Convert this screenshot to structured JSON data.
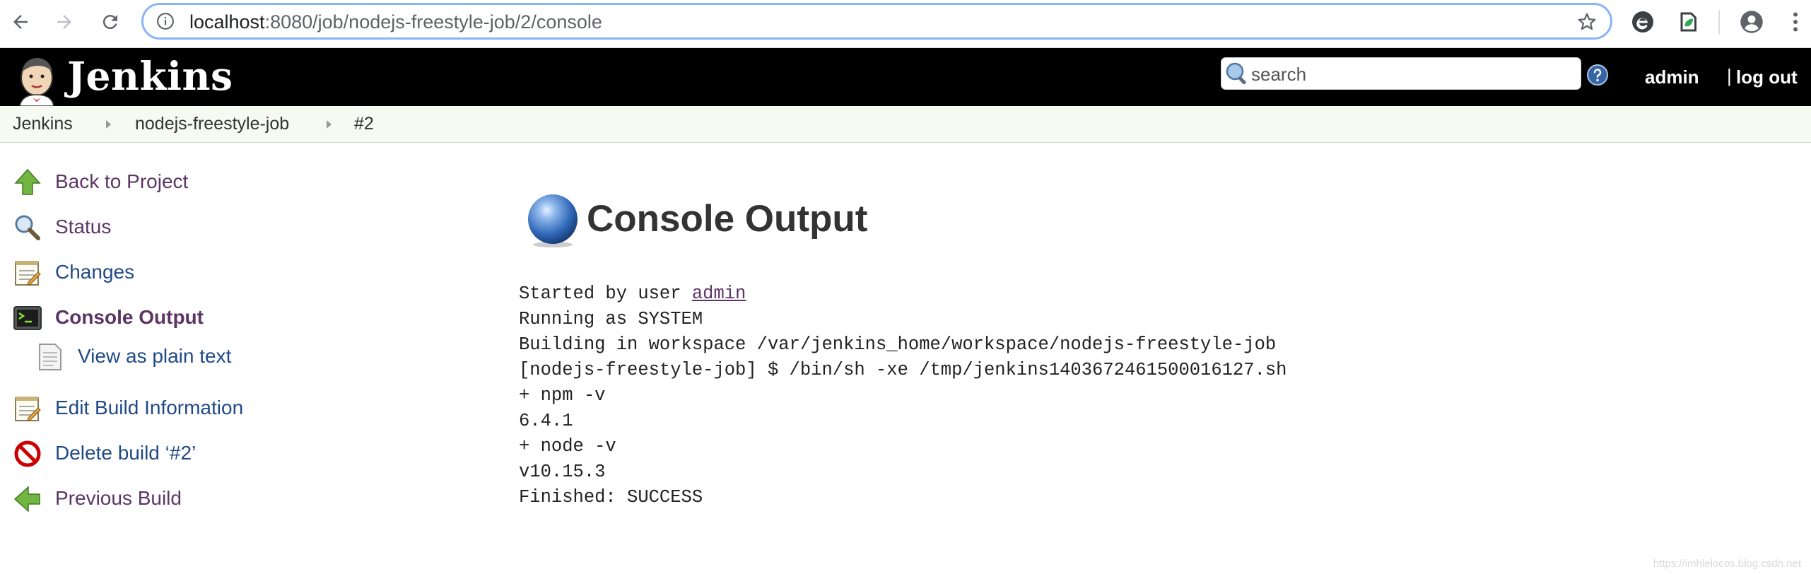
{
  "browser": {
    "back_icon": "arrow-left-icon",
    "forward_icon": "arrow-right-icon",
    "reload_icon": "reload-icon",
    "url_host": "localhost",
    "url_rest": ":8080/job/nodejs-freestyle-job/2/console",
    "bookmark_icon": "star-icon",
    "extensions": [
      "extension-e-icon",
      "extension-leaf-icon"
    ],
    "profile_icon": "profile-icon",
    "menu_icon": "kebab-menu-icon"
  },
  "header": {
    "brand": "Jenkins",
    "search_placeholder": "search",
    "user": "admin",
    "separator": "|",
    "logout": "log out"
  },
  "breadcrumb": [
    "Jenkins",
    "nodejs-freestyle-job",
    "#2"
  ],
  "sidebar": {
    "items": [
      {
        "label": "Back to Project",
        "icon": "up-arrow-icon"
      },
      {
        "label": "Status",
        "icon": "magnifier-icon"
      },
      {
        "label": "Changes",
        "icon": "notepad-icon"
      },
      {
        "label": "Console Output",
        "icon": "terminal-icon"
      },
      {
        "label": "View as plain text",
        "icon": "document-icon"
      },
      {
        "label": "Edit Build Information",
        "icon": "notepad-icon"
      },
      {
        "label": "Delete build ‘#2’",
        "icon": "no-entry-icon"
      },
      {
        "label": "Previous Build",
        "icon": "left-arrow-icon"
      }
    ]
  },
  "main": {
    "title": "Console Output",
    "console_prefix": "Started by user ",
    "console_user": "admin",
    "console_rest": "Running as SYSTEM\nBuilding in workspace /var/jenkins_home/workspace/nodejs-freestyle-job\n[nodejs-freestyle-job] $ /bin/sh -xe /tmp/jenkins1403672461500016127.sh\n+ npm -v\n6.4.1\n+ node -v\nv10.15.3\nFinished: SUCCESS"
  },
  "watermark": "https://imhlelocos.blog.csdn.net"
}
